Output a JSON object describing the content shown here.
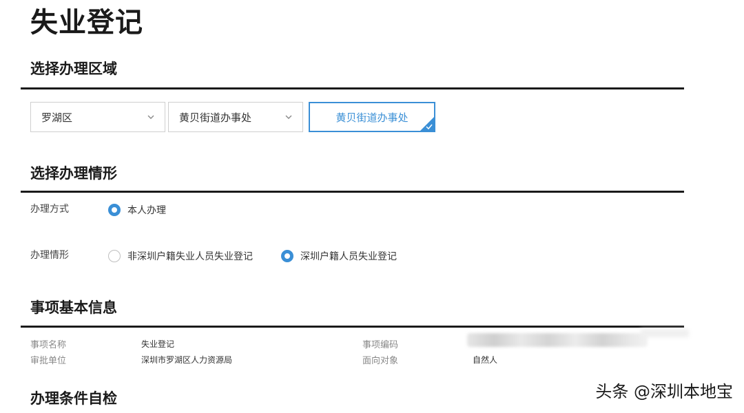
{
  "page": {
    "title": "失业登记"
  },
  "sections": {
    "region": {
      "title": "选择办理区域"
    },
    "situation": {
      "title": "选择办理情形"
    },
    "basic_info": {
      "title": "事项基本信息"
    },
    "self_check": {
      "title": "办理条件自检"
    }
  },
  "region": {
    "district": {
      "value": "罗湖区"
    },
    "street": {
      "value": "黄贝街道办事处"
    },
    "selected_office": {
      "label": "黄贝街道办事处",
      "selected": true
    }
  },
  "situation": {
    "method": {
      "label": "办理方式",
      "options": [
        {
          "label": "本人办理",
          "checked": true
        }
      ]
    },
    "case": {
      "label": "办理情形",
      "options": [
        {
          "label": "非深圳户籍失业人员失业登记",
          "checked": false
        },
        {
          "label": "深圳户籍人员失业登记",
          "checked": true
        }
      ]
    }
  },
  "basic_info": {
    "item_name": {
      "label": "事项名称",
      "value": "失业登记"
    },
    "approval_unit": {
      "label": "审批单位",
      "value": "深圳市罗湖区人力资源局"
    },
    "item_code": {
      "label": "事项编码",
      "value": ""
    },
    "target": {
      "label": "面向对象",
      "value": "自然人"
    }
  },
  "watermark": {
    "text": "头条 @深圳本地宝"
  },
  "colors": {
    "accent": "#3a8fd6",
    "heading": "#1a1a1a",
    "border": "#cfcfcf"
  }
}
